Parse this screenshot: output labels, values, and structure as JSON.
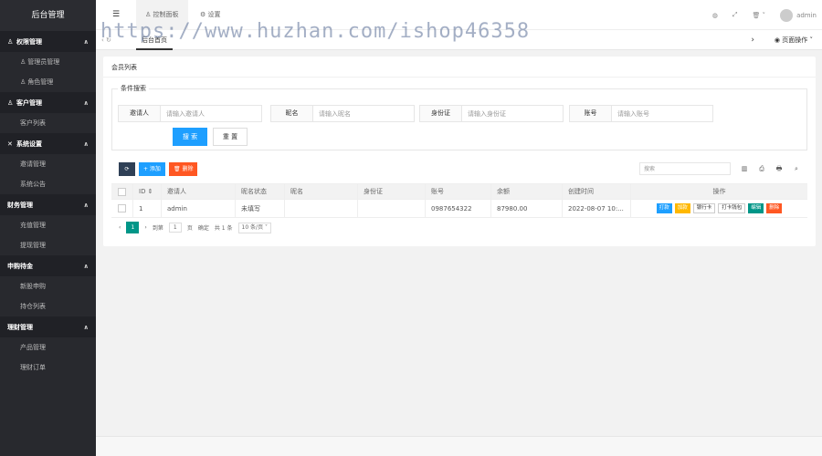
{
  "sidebar": {
    "brand": "后台管理",
    "groups": [
      {
        "title": "权限管理",
        "icon": "person",
        "items": [
          "管理员管理",
          "角色管理"
        ]
      },
      {
        "title": "客户管理",
        "icon": "",
        "items": [
          "客户列表"
        ]
      },
      {
        "title": "系统设置",
        "icon": "tools",
        "items": [
          "邀请管理",
          "系统公告"
        ]
      },
      {
        "title": "财务管理",
        "icon": "",
        "items": [
          "充值管理",
          "提现管理"
        ]
      },
      {
        "title": "申购待金",
        "icon": "",
        "items": [
          "新股申购",
          "持仓列表"
        ]
      },
      {
        "title": "理财管理",
        "icon": "",
        "items": [
          "产品管理",
          "理财订单"
        ]
      }
    ]
  },
  "topbar": {
    "menu_icon": "☰",
    "tabs": [
      {
        "label": "控制面板",
        "icon": "person"
      },
      {
        "label": "设置",
        "icon": "gear"
      }
    ],
    "user": "admin"
  },
  "page_tabs": {
    "current": "后台首页",
    "ops_label": "页面操作"
  },
  "watermark": "https://www.huzhan.com/ishop46358",
  "card": {
    "title": "会员列表",
    "search": {
      "legend": "条件搜索",
      "fields": [
        {
          "label": "邀请人",
          "placeholder": "请输入邀请人"
        },
        {
          "label": "昵名",
          "placeholder": "请输入昵名"
        },
        {
          "label": "身份证",
          "placeholder": "请输入身份证"
        },
        {
          "label": "账号",
          "placeholder": "请输入账号"
        }
      ],
      "search_btn": "搜 索",
      "reset_btn": "重 置"
    },
    "toolbar": {
      "refresh_icon": "⟳",
      "add_label": "+ 添加",
      "delete_label": "🗑 删除",
      "search_placeholder": "搜索"
    },
    "table": {
      "headers": [
        "",
        "ID ⇕",
        "邀请人",
        "昵名状态",
        "昵名",
        "身份证",
        "账号",
        "余额",
        "创建时间",
        "操作"
      ],
      "rows": [
        {
          "id": "1",
          "inviter": "admin",
          "status": "未填写",
          "name": "",
          "idcard": "",
          "account": "0987654322",
          "balance": "87980.00",
          "created": "2022-08-07 10:...",
          "ops": [
            "打款",
            "加款",
            "银行卡",
            "打卡钱包",
            "编辑",
            "删除"
          ]
        }
      ]
    },
    "pager": {
      "prev": "‹",
      "current": "1",
      "next": "›",
      "goto_label": "到第",
      "goto_value": "1",
      "page_unit": "页",
      "confirm": "确定",
      "total": "共 1 条",
      "per_page": "10 条/页"
    }
  }
}
